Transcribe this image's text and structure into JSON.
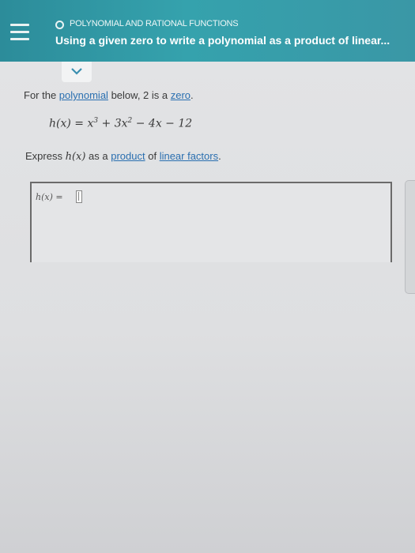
{
  "header": {
    "topic": "POLYNOMIAL AND RATIONAL FUNCTIONS",
    "lesson_title": "Using a given zero to write a polynomial as a product of linear..."
  },
  "icons": {
    "menu": "hamburger-menu-icon",
    "topic_status": "circle-icon",
    "expand": "chevron-down-icon"
  },
  "problem": {
    "prompt_before": "For the ",
    "prompt_link1": "polynomial",
    "prompt_middle": " below, 2 is a ",
    "prompt_link2": "zero",
    "prompt_after": ".",
    "equation_lhs": "h(x) = x",
    "equation_exp1": "3",
    "equation_mid": " + 3x",
    "equation_exp2": "2",
    "equation_rest": " − 4x − 12",
    "instruction_before": "Express ",
    "instruction_fn": "h(x)",
    "instruction_middle": " as a ",
    "instruction_link1": "product",
    "instruction_of": " of ",
    "instruction_link2": "linear factors",
    "instruction_after": "."
  },
  "answer": {
    "label": "h(x) =",
    "value": ""
  },
  "colors": {
    "header_teal": "#35a2ad",
    "link_blue": "#2a6fb0"
  }
}
